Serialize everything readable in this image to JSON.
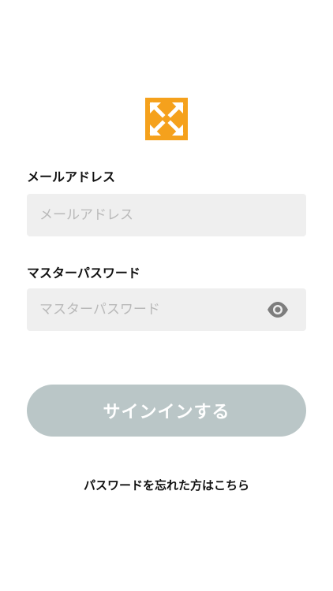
{
  "brand": {
    "logo_icon": "orange-arrows-logo-icon",
    "accent_color": "#f5a11c"
  },
  "email": {
    "label": "メールアドレス",
    "placeholder": "メールアドレス",
    "value": ""
  },
  "password": {
    "label": "マスターパスワード",
    "placeholder": "マスターパスワード",
    "value": "",
    "toggle_icon": "eye-icon"
  },
  "signin_button": {
    "label": "サインインする",
    "color": "#bac6c7"
  },
  "forgot_link": {
    "label": "パスワードを忘れた方はこちら"
  }
}
